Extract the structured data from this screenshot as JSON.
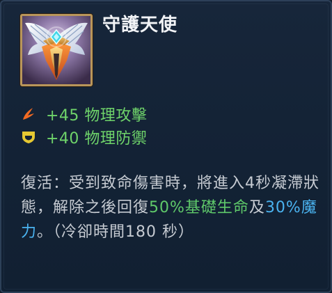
{
  "item": {
    "name": "守護天使",
    "icon": "guardian-angel-icon"
  },
  "stats": [
    {
      "icon": "physical-attack-icon",
      "text": "+45 物理攻擊",
      "color": "#6fd46a"
    },
    {
      "icon": "physical-defense-icon",
      "text": "+40 物理防禦",
      "color": "#6fd46a"
    }
  ],
  "description": {
    "part1": "復活：受到致命傷害時，將進入4秒凝滯狀態，解除之後回復",
    "hp": "50%基礎生命",
    "and": "及",
    "mana": "30%魔力",
    "part2": "。（冷卻時間180 秒）"
  },
  "colors": {
    "stat_green": "#6fd46a",
    "hp_green": "#5fc96a",
    "mana_blue": "#4ab3f0",
    "attack_icon": "#f26a22",
    "defense_icon": "#e6c832",
    "frame_gold": "#b9965a"
  }
}
